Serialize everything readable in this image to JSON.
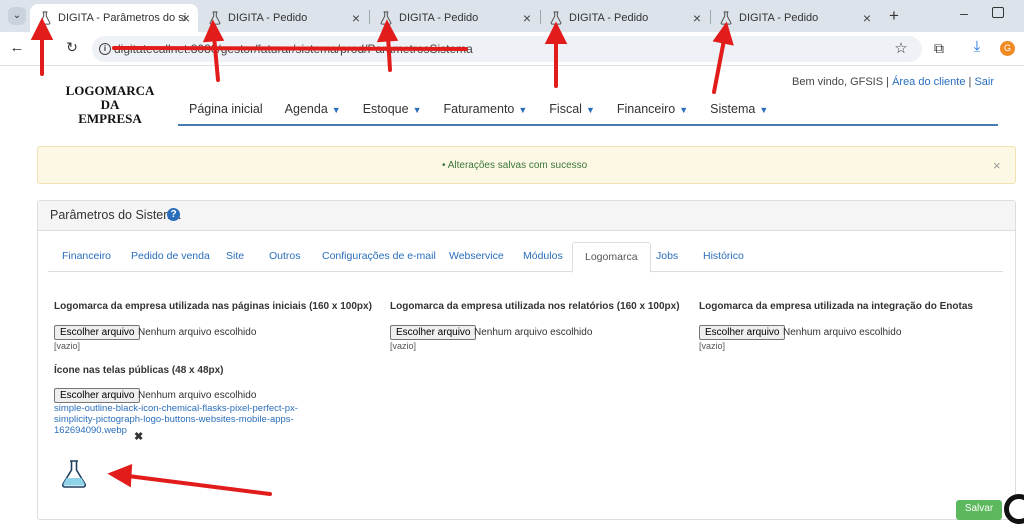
{
  "browser": {
    "tabs": [
      {
        "title": "DIGITA - Parâmetros do siste",
        "active": true
      },
      {
        "title": "DIGITA - Pedido",
        "active": false
      },
      {
        "title": "DIGITA - Pedido",
        "active": false
      },
      {
        "title": "DIGITA - Pedido",
        "active": false
      },
      {
        "title": "DIGITA - Pedido",
        "active": false
      }
    ],
    "new_tab": "+",
    "url": "digitatecallnet:8080/gestor/faturar/sistema/prod/ParametrosSistema"
  },
  "header": {
    "logo_line1": "LOGOMARCA",
    "logo_line2": "DA",
    "logo_line3": "EMPRESA",
    "welcome": "Bem vindo, GFSIS |",
    "client_area": "Área do cliente",
    "pipe": "|",
    "logout": "Sair"
  },
  "nav": [
    {
      "label": "Página inicial",
      "dropdown": false
    },
    {
      "label": "Agenda",
      "dropdown": true
    },
    {
      "label": "Estoque",
      "dropdown": true
    },
    {
      "label": "Faturamento",
      "dropdown": true
    },
    {
      "label": "Fiscal",
      "dropdown": true
    },
    {
      "label": "Financeiro",
      "dropdown": true
    },
    {
      "label": "Sistema",
      "dropdown": true
    }
  ],
  "alert": {
    "message": "•  Alterações salvas com sucesso",
    "close": "×"
  },
  "panel": {
    "title": "Parâmetros do Sistema",
    "help": "?",
    "tabs": [
      "Financeiro",
      "Pedido de venda",
      "Site",
      "Outros",
      "Configurações de e-mail",
      "Webservice",
      "Módulos",
      "Logomarca",
      "Jobs",
      "Histórico"
    ],
    "active_tab": "Logomarca"
  },
  "fields": {
    "button_label": "Escolher arquivo",
    "no_file": "Nenhum arquivo escolhido",
    "empty": "[vazio]",
    "logo_home": "Logomarca da empresa utilizada nas páginas iniciais (160 x 100px)",
    "logo_reports": "Logomarca da empresa utilizada nos relatórios (160 x 100px)",
    "logo_enotas": "Logomarca da empresa utilizada na integração do Enotas",
    "icon_public": "Ícone nas telas públicas (48 x 48px)",
    "icon_file": "simple-outline-black-icon-chemical-flasks-pixel-perfect-px-simplicity-pictograph-logo-buttons-websites-mobile-apps-162694090.webp",
    "remove": "✖"
  },
  "save_label": "Salvar",
  "colors": {
    "accent": "#2a6ebb",
    "alert_bg": "#fcf8e3",
    "success": "#3c763d",
    "save": "#5cb85c",
    "arrow": "#e21b1b"
  }
}
